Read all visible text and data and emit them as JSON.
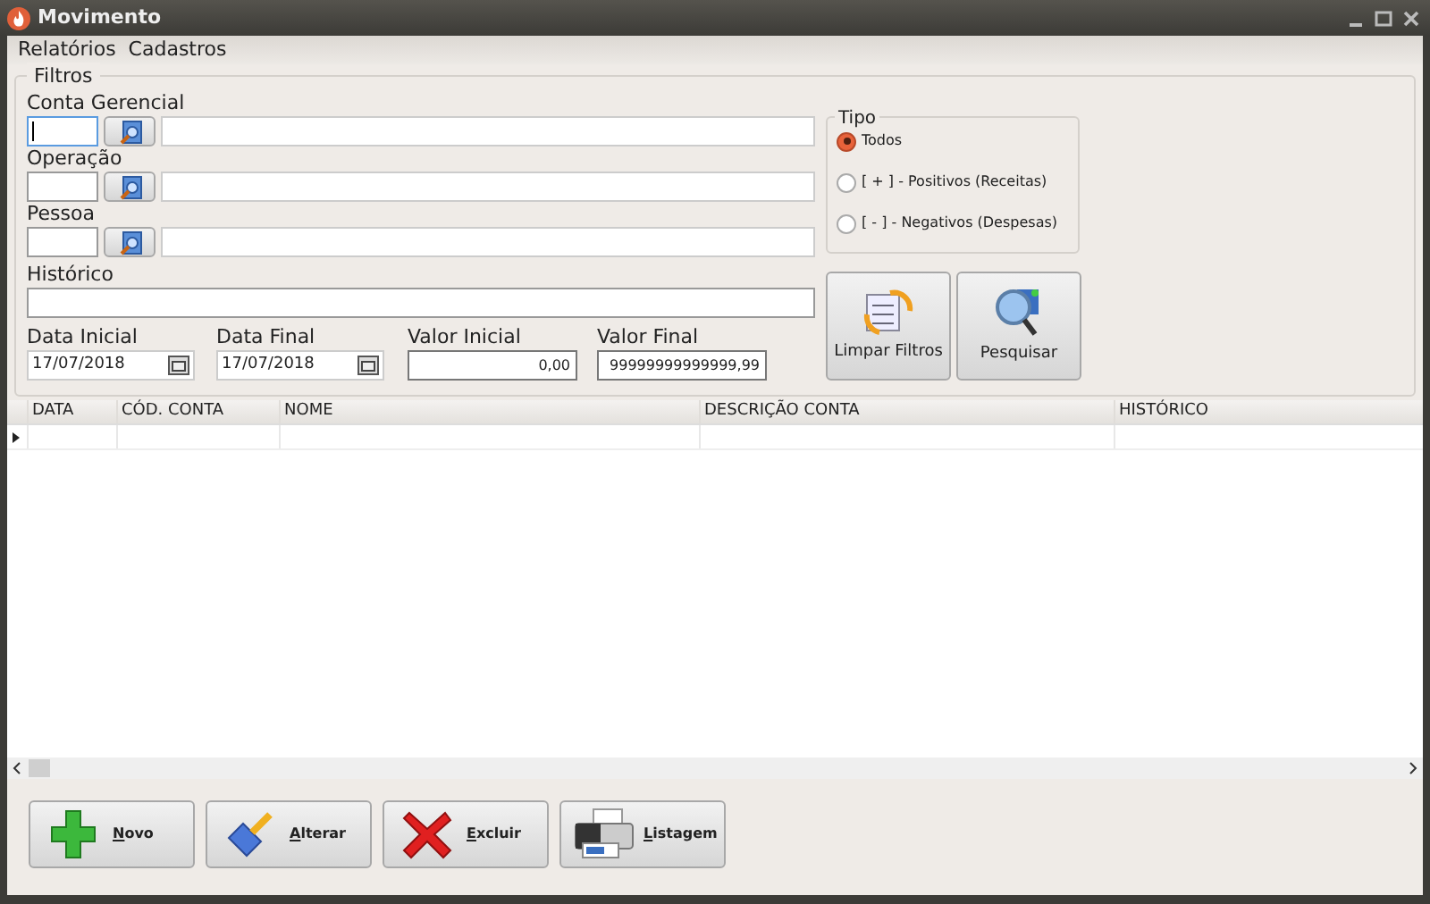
{
  "window": {
    "title": "Movimento"
  },
  "menu": [
    "Relatórios",
    "Cadastros"
  ],
  "filters": {
    "title": "Filtros",
    "lookups": [
      {
        "label": "Conta Gerencial",
        "focused": true
      },
      {
        "label": "Operação",
        "focused": false
      },
      {
        "label": "Pessoa",
        "focused": false
      }
    ],
    "historico": {
      "label": "Histórico"
    },
    "ranges": [
      {
        "kind": "date",
        "label": "Data Inicial",
        "value": "17/07/2018"
      },
      {
        "kind": "date",
        "label": "Data Final",
        "value": "17/07/2018"
      },
      {
        "kind": "number",
        "label": "Valor Inicial",
        "value": "0,00"
      },
      {
        "kind": "number",
        "label": "Valor Final",
        "value": "99999999999999,99"
      }
    ],
    "tipo": {
      "title": "Tipo",
      "options": [
        {
          "label": "Todos",
          "selected": true
        },
        {
          "label": "[ + ] - Positivos (Receitas)",
          "selected": false
        },
        {
          "label": "[ - ] - Negativos (Despesas)",
          "selected": false
        }
      ]
    },
    "actions": [
      {
        "kind": "clear",
        "label": "Limpar Filtros"
      },
      {
        "kind": "search",
        "label": "Pesquisar"
      }
    ]
  },
  "table": {
    "columns": [
      "DATA",
      "CÓD. CONTA",
      "NOME",
      "DESCRIÇÃO CONTA",
      "HISTÓRICO"
    ]
  },
  "buttons": [
    {
      "kind": "new",
      "label": "Novo",
      "underline_first": true
    },
    {
      "kind": "edit",
      "label": "Alterar",
      "underline_first": true
    },
    {
      "kind": "delete",
      "label": "Excluir",
      "underline_first": true
    },
    {
      "kind": "print",
      "label": "Listagem",
      "underline_first": true
    }
  ]
}
